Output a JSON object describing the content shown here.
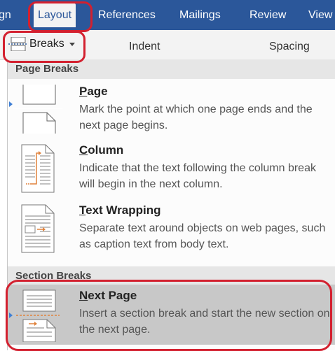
{
  "ribbon": {
    "tabs": [
      {
        "label": "gn"
      },
      {
        "label": "Layout"
      },
      {
        "label": "References"
      },
      {
        "label": "Mailings"
      },
      {
        "label": "Review"
      },
      {
        "label": "View"
      }
    ],
    "active_tab": "Layout",
    "breaks_label": "Breaks",
    "indent_label": "Indent",
    "spacing_label": "Spacing"
  },
  "menu": {
    "page_breaks_header": "Page Breaks",
    "section_breaks_header": "Section Breaks",
    "items": [
      {
        "title_ul": "P",
        "title_rest": "age",
        "desc": "Mark the point at which one page ends and the next page begins."
      },
      {
        "title_ul": "C",
        "title_rest": "olumn",
        "desc": "Indicate that the text following the column break will begin in the next column."
      },
      {
        "title_ul": "T",
        "title_rest": "ext Wrapping",
        "desc": "Separate text around objects on web pages, such as caption text from body text."
      },
      {
        "title_ul": "N",
        "title_rest": "ext Page",
        "desc": "Insert a section break and start the new section on the next page.",
        "selected": true
      }
    ]
  },
  "colors": {
    "ribbon_blue": "#2b579a",
    "highlight_red": "#d3202f",
    "accent_orange": "#e0823c",
    "selected_gray": "#c8c8c8"
  }
}
